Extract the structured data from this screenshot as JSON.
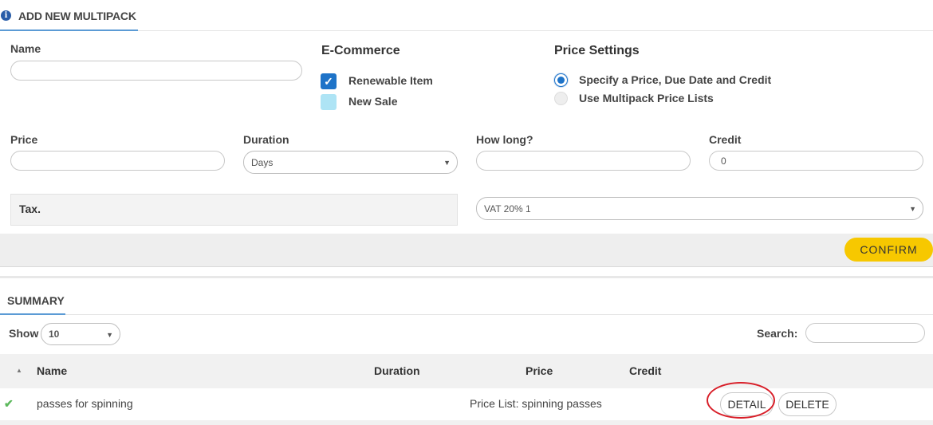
{
  "header": {
    "title": "ADD NEW MULTIPACK",
    "info_icon": "info-icon"
  },
  "form": {
    "name_label": "Name",
    "name_value": "",
    "ecommerce": {
      "title": "E-Commerce",
      "renewable": {
        "label": "Renewable Item",
        "checked": true
      },
      "new_sale": {
        "label": "New Sale",
        "checked": false
      }
    },
    "price_settings": {
      "title": "Price Settings",
      "options": [
        {
          "label": "Specify a Price, Due Date and Credit",
          "selected": true
        },
        {
          "label": "Use Multipack Price Lists",
          "selected": false
        }
      ]
    },
    "price_label": "Price",
    "price_value": "",
    "duration_label": "Duration",
    "duration_value": "Days",
    "how_long_label": "How long?",
    "how_long_value": "",
    "credit_label": "Credit",
    "credit_value": "0",
    "tax_label": "Tax.",
    "tax_value": "VAT 20% 1",
    "confirm_label": "CONFIRM"
  },
  "summary": {
    "title": "SUMMARY",
    "show_label": "Show",
    "show_value": "10",
    "search_label": "Search:",
    "search_value": "",
    "columns": [
      "Name",
      "Duration",
      "Price",
      "Credit"
    ],
    "rows": [
      {
        "name": "passes for spinning",
        "duration": "",
        "price": "Price List: spinning passes",
        "credit": "",
        "detail_label": "DETAIL",
        "delete_label": "DELETE"
      }
    ]
  },
  "colors": {
    "accent": "#1e73c8",
    "confirm": "#f7c800",
    "highlight": "#d81e28",
    "tab_underline": "#5b9bd5"
  }
}
